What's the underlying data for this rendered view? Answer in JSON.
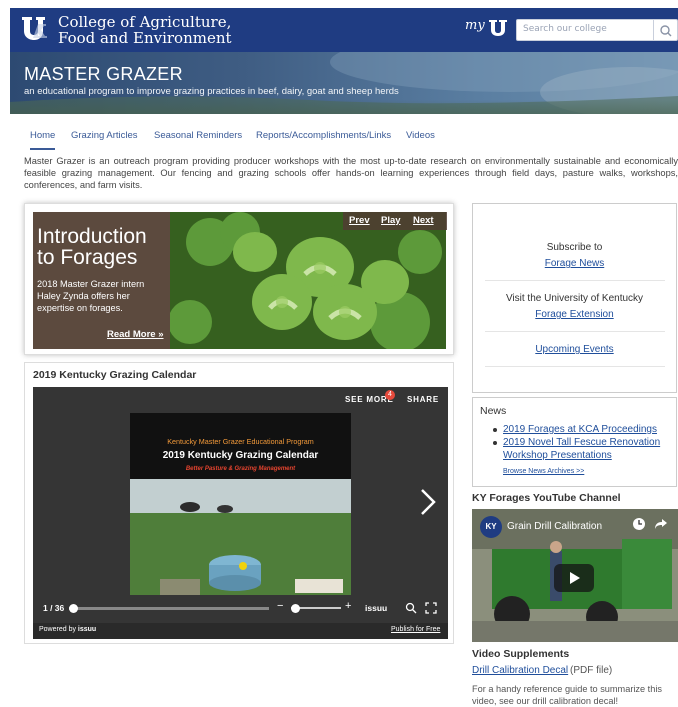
{
  "header": {
    "college_line1": "College of Agriculture,",
    "college_line2": "Food and Environment",
    "myuk_label": "my",
    "search_placeholder": "Search our college",
    "brand_color": "#1f3c82"
  },
  "hero": {
    "title": "MASTER GRAZER",
    "subtitle": "an educational program to improve grazing practices in beef, dairy, goat and sheep herds"
  },
  "nav": {
    "items": [
      "Home",
      "Grazing Articles",
      "Seasonal Reminders",
      "Reports/Accomplishments/Links",
      "Videos"
    ],
    "active": "Home"
  },
  "intro": "Master Grazer is an outreach program providing producer workshops with the most up-to-date research on environmentally sustainable and economically feasible grazing management.  Our fencing and grazing schools offer hands-on learning experiences through field days, pasture walks, workshops, conferences, and farm visits.",
  "slider": {
    "title_line1": "Introduction",
    "title_line2": "to Forages",
    "text": "2018 Master Grazer intern Haley Zynda offers her expertise on forages.",
    "read_more": "Read More »",
    "prev": "Prev",
    "play": "Play",
    "next": "Next"
  },
  "calendar": {
    "title": "2019 Kentucky Grazing Calendar",
    "see_more": "SEE MORE",
    "badge": "4",
    "share": "SHARE",
    "page_line1": "Kentucky Master Grazer Educational Program",
    "page_line2": "2019 Kentucky Grazing Calendar",
    "page_line3": "Better Pasture & Grazing Management",
    "page_counter": "1 / 36",
    "issuu": "issuu",
    "powered_by": "Powered by",
    "publish": "Publish for Free"
  },
  "sidebar": {
    "subscribe_line1": "Subscribe to",
    "subscribe_link": "Forage News",
    "visit_line1": "Visit the University of Kentucky",
    "visit_link": "Forage Extension",
    "events_link": "Upcoming Events"
  },
  "news": {
    "title": "News",
    "item1": "2019 Forages at KCA Proceedings",
    "item2": "2019 Novel Tall Fescue Renovation Workshop Presentations",
    "archives": "Browse News Archives >>"
  },
  "youtube": {
    "section_title": "KY Forages YouTube Channel",
    "video_title": "Grain Drill Calibration",
    "channel_badge": "KY"
  },
  "supplements": {
    "title": "Video Supplements",
    "link": "Drill Calibration Decal",
    "pdf_note": "(PDF file)",
    "description": "For a handy reference guide to summarize this video, see our drill calibration decal!"
  }
}
